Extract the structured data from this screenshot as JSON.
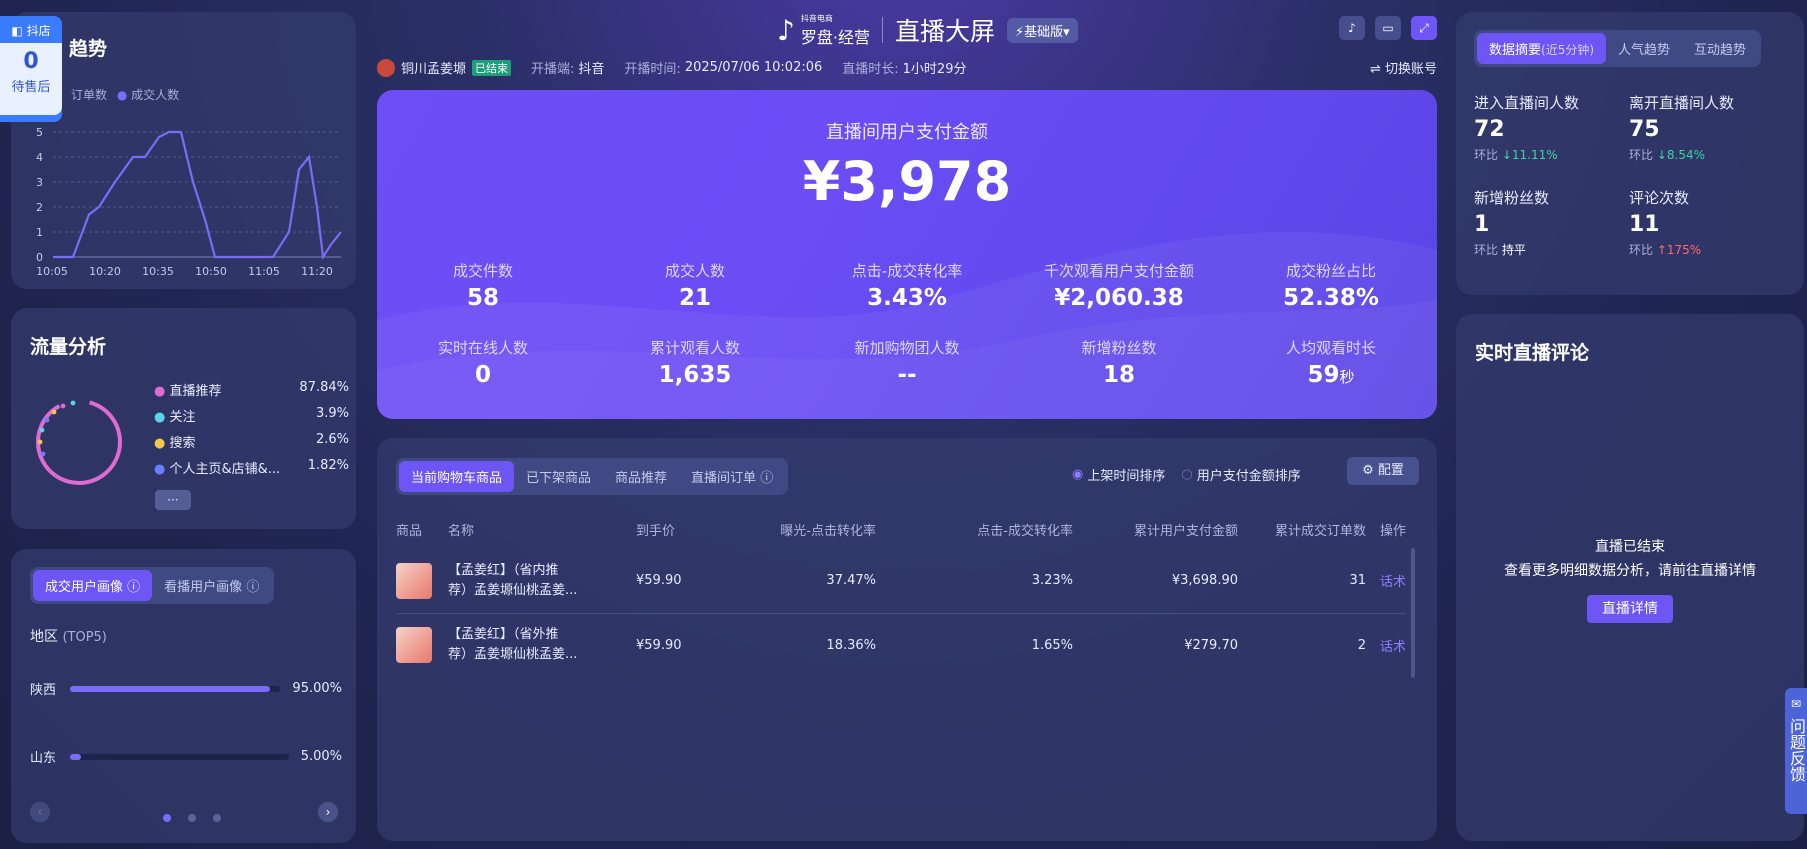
{
  "badge": {
    "label": "抖店",
    "count": "0",
    "sublabel": "待售后"
  },
  "trend": {
    "title": "成交趋势",
    "title_visible": "实时趋势",
    "legend": [
      "订单数",
      "成交人数"
    ],
    "yticks": [
      "0",
      "1",
      "2",
      "3",
      "4",
      "5"
    ],
    "xticks": [
      "10:05",
      "10:20",
      "10:35",
      "10:50",
      "11:05",
      "11:20"
    ]
  },
  "traffic": {
    "title": "流量分析",
    "items": [
      {
        "label": "直播推荐",
        "value": "87.84%",
        "color": "#e06bd0"
      },
      {
        "label": "关注",
        "value": "3.9%",
        "color": "#5fd3e8"
      },
      {
        "label": "搜索",
        "value": "2.6%",
        "color": "#f2c94c"
      },
      {
        "label": "个人主页&店铺&...",
        "value": "1.82%",
        "color": "#6b7cff"
      }
    ],
    "more": "···"
  },
  "portrait": {
    "tabs": [
      "成交用户画像",
      "看播用户画像"
    ],
    "region_title": "地区",
    "region_sub": "(TOP5)",
    "regions": [
      {
        "name": "陕西",
        "value": "95.00%",
        "pct": 0.95
      },
      {
        "name": "山东",
        "value": "5.00%",
        "pct": 0.05
      }
    ]
  },
  "header": {
    "brand_small": "抖音电商",
    "brand": "罗盘·经营",
    "title": "直播大屏",
    "version": "基础版",
    "shop": "铜川孟姜塬",
    "status": "已结束",
    "platform_label": "开播端:",
    "platform": "抖音",
    "start_label": "开播时间:",
    "start": "2025/07/06 10:02:06",
    "duration_label": "直播时长:",
    "duration": "1小时29分",
    "switch": "切换账号"
  },
  "hero": {
    "label": "直播间用户支付金额",
    "amount": "¥3,978",
    "stats": [
      {
        "label": "成交件数",
        "value": "58"
      },
      {
        "label": "成交人数",
        "value": "21"
      },
      {
        "label": "点击-成交转化率",
        "value": "3.43%"
      },
      {
        "label": "千次观看用户支付金额",
        "value": "¥2,060.38"
      },
      {
        "label": "成交粉丝占比",
        "value": "52.38%"
      },
      {
        "label": "实时在线人数",
        "value": "0"
      },
      {
        "label": "累计观看人数",
        "value": "1,635"
      },
      {
        "label": "新加购物团人数",
        "value": "--"
      },
      {
        "label": "新增粉丝数",
        "value": "18"
      },
      {
        "label": "人均观看时长",
        "value": "59",
        "unit": "秒"
      }
    ]
  },
  "products": {
    "tabs": [
      "当前购物车商品",
      "已下架商品",
      "商品推荐",
      "直播间订单"
    ],
    "sort_options": [
      "上架时间排序",
      "用户支付金额排序"
    ],
    "config": "配置",
    "columns": [
      "商品",
      "名称",
      "到手价",
      "曝光-点击转化率",
      "点击-成交转化率",
      "累计用户支付金额",
      "累计成交订单数",
      "操作"
    ],
    "rows": [
      {
        "name1": "【孟姜红】（省内推",
        "name2": "荐）孟姜塬仙桃孟姜...",
        "price": "¥59.90",
        "exp_click": "37.47%",
        "click_deal": "3.23%",
        "amount": "¥3,698.90",
        "orders": "31",
        "action": "话术"
      },
      {
        "name1": "【孟姜红】（省外推",
        "name2": "荐）孟姜塬仙桃孟姜...",
        "price": "¥59.90",
        "exp_click": "18.36%",
        "click_deal": "1.65%",
        "amount": "¥279.70",
        "orders": "2",
        "action": "话术"
      }
    ]
  },
  "summary": {
    "tabs": [
      "数据摘要",
      "(近5分钟)",
      "人气趋势",
      "互动趋势"
    ],
    "items": [
      {
        "label": "进入直播间人数",
        "value": "72",
        "cmp": "环比",
        "change": "↓11.11%",
        "dir": "down"
      },
      {
        "label": "离开直播间人数",
        "value": "75",
        "cmp": "环比",
        "change": "↓8.54%",
        "dir": "down"
      },
      {
        "label": "新增粉丝数",
        "value": "1",
        "cmp": "环比",
        "change": "持平",
        "dir": "flat"
      },
      {
        "label": "评论次数",
        "value": "11",
        "cmp": "环比",
        "change": "↑175%",
        "dir": "up"
      }
    ]
  },
  "comments": {
    "title": "实时直播评论",
    "ended": "直播已结束",
    "hint": "查看更多明细数据分析，请前往直播详情",
    "button": "直播详情"
  },
  "feedback": {
    "label": "问题反馈"
  },
  "colors": {
    "accent": "#6d56f5",
    "line": "#7b6cf6",
    "link": "#8f7dff"
  }
}
